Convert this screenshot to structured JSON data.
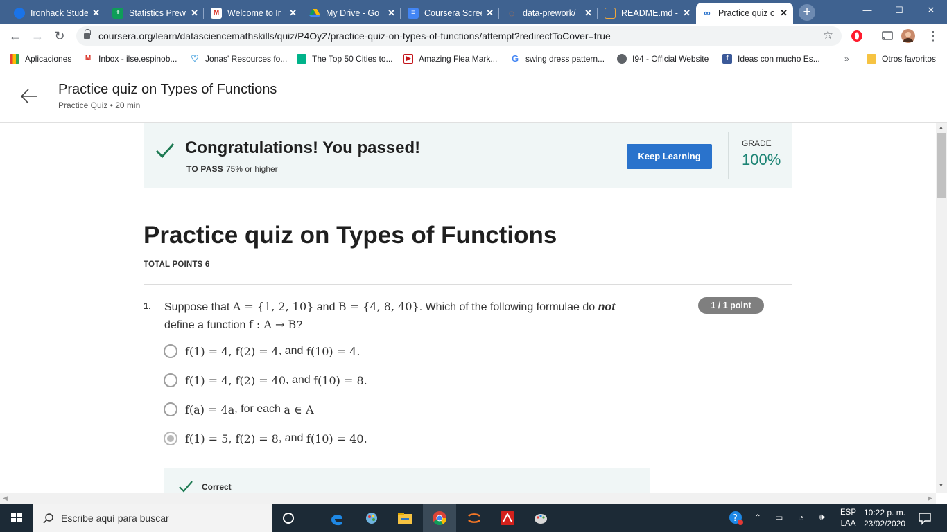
{
  "browser": {
    "tabs": [
      {
        "title": "Ironhack Stude",
        "icon": "ironhack-favicon",
        "color": "#1a73e8",
        "active": false
      },
      {
        "title": "Statistics Prew",
        "icon": "sheets-favicon",
        "color": "#0f9d58",
        "active": false
      },
      {
        "title": "Welcome to Ir",
        "icon": "gmail-favicon",
        "color": "#d93025",
        "active": false
      },
      {
        "title": "My Drive - Go",
        "icon": "drive-favicon",
        "color": "#fbbc04",
        "active": false
      },
      {
        "title": "Coursera Scree",
        "icon": "docs-favicon",
        "color": "#4285f4",
        "active": false
      },
      {
        "title": "data-prework/",
        "icon": "jupyter-favicon",
        "color": "#f37626",
        "active": false
      },
      {
        "title": "README.md -",
        "icon": "file-favicon",
        "color": "#f2a93b",
        "active": false
      },
      {
        "title": "Practice quiz c",
        "icon": "coursera-favicon",
        "color": "#2a73cc",
        "active": true
      }
    ],
    "url": "coursera.org/learn/datasciencemathskills/quiz/P4OyZ/practice-quiz-on-types-of-functions/attempt?redirectToCover=true",
    "bookmarks": [
      {
        "label": "Aplicaciones",
        "icon": "apps-grid-icon"
      },
      {
        "label": "Inbox - ilse.espinob...",
        "icon": "gmail-icon"
      },
      {
        "label": "Jonas' Resources fo...",
        "icon": "heart-icon"
      },
      {
        "label": "The Top 50 Cities to...",
        "icon": "bookmark-green-icon"
      },
      {
        "label": "Amazing Flea Mark...",
        "icon": "play-icon"
      },
      {
        "label": "swing dress pattern...",
        "icon": "google-icon"
      },
      {
        "label": "I94 - Official Website",
        "icon": "globe-icon"
      },
      {
        "label": "Ideas con mucho Es...",
        "icon": "facebook-icon"
      }
    ],
    "more_bookmarks": "»",
    "other_bookmarks": "Otros favoritos"
  },
  "header": {
    "title": "Practice quiz on Types of Functions",
    "subtitle": "Practice Quiz • 20 min"
  },
  "result": {
    "message": "Congratulations! You passed!",
    "to_pass_label": "TO PASS",
    "to_pass_value": "75% or higher",
    "button": "Keep Learning",
    "grade_label": "GRADE",
    "grade_value": "100%"
  },
  "quiz": {
    "title": "Practice quiz on Types of Functions",
    "total_points": "TOTAL POINTS 6",
    "question": {
      "number": "1.",
      "text_before": "Suppose that",
      "math_a": "A = {1, 2, 10}",
      "and": "and",
      "math_b": "B = {4, 8, 40}",
      "text_mid": ". Which of the following formulae do",
      "not": "not",
      "text_line2": "define a function",
      "math_f": "f : A → B",
      "text_end": "?",
      "points": "1 / 1 point",
      "options": [
        {
          "math1": "f(1) = 4, f(2) = 4",
          "joiner": ", and",
          "math2": "f(10) = 4.",
          "selected": false
        },
        {
          "math1": "f(1) = 4, f(2) = 40",
          "joiner": ", and",
          "math2": "f(10) = 8.",
          "selected": false
        },
        {
          "math1": "f(a) = 4a",
          "joiner": ", for each",
          "math2": "a ∈ A",
          "selected": false
        },
        {
          "math1": "f(1) = 5, f(2) = 8",
          "joiner": ", and",
          "math2": "f(10) = 40.",
          "selected": true
        }
      ],
      "feedback": "Correct"
    }
  },
  "taskbar": {
    "search_placeholder": "Escribe aquí para buscar",
    "lang1": "ESP",
    "lang2": "LAA",
    "time": "10:22 p. m.",
    "date": "23/02/2020"
  }
}
